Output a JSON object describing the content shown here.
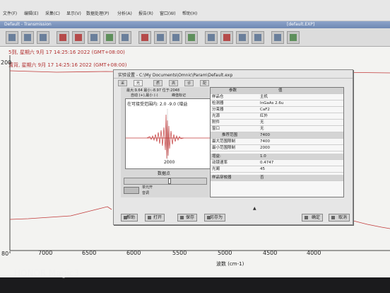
{
  "menu": {
    "items": [
      "文件(F)",
      "编辑(E)",
      "采集(C)",
      "显示(V)",
      "数据处理(P)",
      "分析(A)",
      "报告(R)",
      "窗口(W)",
      "帮助(H)"
    ]
  },
  "window": {
    "title": "Default - Transmission",
    "right_title": "[default.EXP]"
  },
  "toolbar": {
    "icons": [
      "open-icon",
      "save-icon",
      "print-icon",
      "collect-icon",
      "background-icon",
      "settings-icon",
      "experiment-icon",
      "library-icon",
      "peak-icon",
      "baseline-icon",
      "subtract-icon",
      "zoom-icon",
      "report-icon",
      "search-icon",
      "ratio-icon",
      "normalize-icon",
      "export-icon",
      "help-icon"
    ]
  },
  "spectrum": {
    "timestamp_1": "5到, 星期六 9月 17 14:25:16 2022 (GMT+08:00)",
    "timestamp_2": "置背, 星期六 9月 17 14:25:16 2022 (GMT+08:00)",
    "y_tick_top": "200",
    "y_tick_mid": "80",
    "x_ticks": [
      "7000",
      "6500",
      "6000",
      "5500",
      "5000",
      "4500",
      "4000"
    ],
    "xlabel": "波数 (cm-1)"
  },
  "dialog": {
    "title": "实验设置 - C:\\My Documents\\Omnic\\Param\\Default.exp",
    "tabs": [
      "采集",
      "光学台",
      "质量",
      "高级",
      "诊断",
      "配置"
    ],
    "stats": "最大:9.64  最小:-8.97  位于:2048",
    "checkbox_label": "自动 (+),最小 (-)",
    "checkbox_label2": "峰值标记",
    "range_text": "在可接受范围内: 2.0  -9.0 (增益",
    "ip_x_value": "2000",
    "ip_xlabel": "数据点",
    "control_label_1": "单元开",
    "control_label_2": "音调",
    "table_headers": [
      "参数",
      "值"
    ],
    "rows": [
      {
        "k": "样品仓",
        "v": "主机"
      },
      {
        "k": "检测器",
        "v": "InGaAs 2.6u"
      },
      {
        "k": "分束器",
        "v": "CaF2"
      },
      {
        "k": "光源",
        "v": "红外"
      },
      {
        "k": "附件",
        "v": "无"
      },
      {
        "k": "窗口",
        "v": "无"
      },
      {
        "k": "推荐范围",
        "v": "7400"
      },
      {
        "k": "最大范围限制",
        "v": "7400"
      },
      {
        "k": "最小范围限制",
        "v": "2000"
      },
      {
        "k": "增益:",
        "v": "1.0"
      },
      {
        "k": "动镜速率",
        "v": "0.4747"
      },
      {
        "k": "光阑",
        "v": "45"
      },
      {
        "k": "样品穿梭器",
        "v": "否"
      }
    ],
    "footer_buttons": [
      "帮助",
      "打开",
      "保存",
      "另存为",
      "确定",
      "取消"
    ]
  },
  "watermark": "HONOR Magic3"
}
